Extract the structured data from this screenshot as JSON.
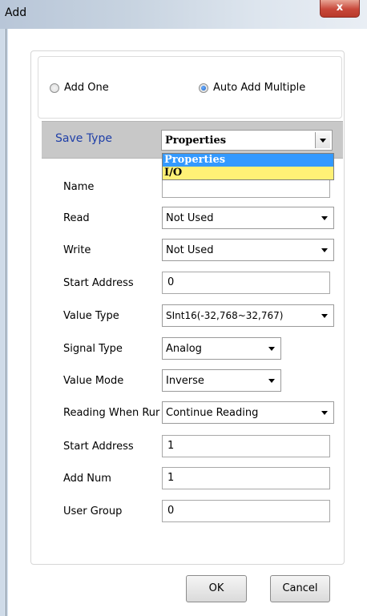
{
  "window": {
    "title": "Add",
    "close_glyph": "x"
  },
  "mode": {
    "options": [
      {
        "label": "Add One",
        "selected": false
      },
      {
        "label": "Auto Add Multiple",
        "selected": true
      }
    ]
  },
  "save_type": {
    "label": "Save Type",
    "value": "Properties",
    "dropdown_options": [
      "Properties",
      "I/O"
    ],
    "highlighted_option": "I/O"
  },
  "fields": {
    "name": {
      "label": "Name",
      "value": ""
    },
    "read": {
      "label": "Read",
      "value": "Not Used"
    },
    "write": {
      "label": "Write",
      "value": "Not Used"
    },
    "start_address": {
      "label": "Start Address",
      "value": "0"
    },
    "value_type": {
      "label": "Value Type",
      "value": "SInt16(-32,768~32,767)"
    },
    "signal_type": {
      "label": "Signal Type",
      "value": "Analog"
    },
    "value_mode": {
      "label": "Value Mode",
      "value": "Inverse"
    },
    "reading_when_run": {
      "label": "Reading When Rur",
      "value": "Continue Reading"
    },
    "start_address_2": {
      "label": "Start Address",
      "value": "1"
    },
    "add_num": {
      "label": "Add Num",
      "value": "1"
    },
    "user_group": {
      "label": "User Group",
      "value": "0"
    }
  },
  "buttons": {
    "ok": "OK",
    "cancel": "Cancel"
  },
  "colors": {
    "save_type_label": "#1f3fa8",
    "selected_option": "#3399ff",
    "hover_option": "#fff176"
  }
}
